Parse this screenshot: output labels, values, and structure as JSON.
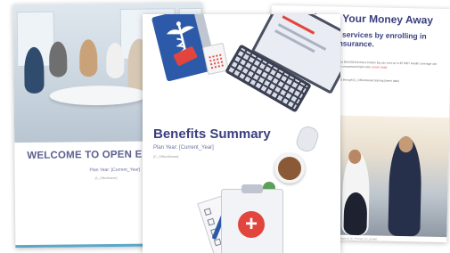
{
  "left_card": {
    "title": "WELCOME TO OPEN ENROLLMENT",
    "plan_year": "Plan Year: [Current_Year]",
    "office_name": "[C_OfficeName]"
  },
  "center_card": {
    "title": "Benefits Summary",
    "plan_year": "Plan Year: [Current_Year]",
    "office_name": "[C_OfficeName]"
  },
  "right_card": {
    "heading": "hrow Your Money Away",
    "subheading": "medical services by enrolling in health insurance.",
    "body": "How do hospitals bill a $40,000 bill that a broken leg can cost up to $7,500? Health coverage can help protect you from unexpected high costs.",
    "body_link": "[insert date]",
    "body2": "Health plans provided through [C_OfficeName] starting [insert date]",
    "caption": "[C_OfficeName] | [C_Phone] | [C_Email]"
  },
  "colors": {
    "heading_navy": "#3a3f80",
    "accent_red": "#e2453d",
    "folder_blue": "#2d5aa8",
    "border_teal": "#5aa7c9"
  },
  "icons": [
    "medical-caduceus-icon",
    "plus-icon",
    "calculator-icon",
    "coffee-cup-icon",
    "pen-icon",
    "checklist-icon"
  ]
}
